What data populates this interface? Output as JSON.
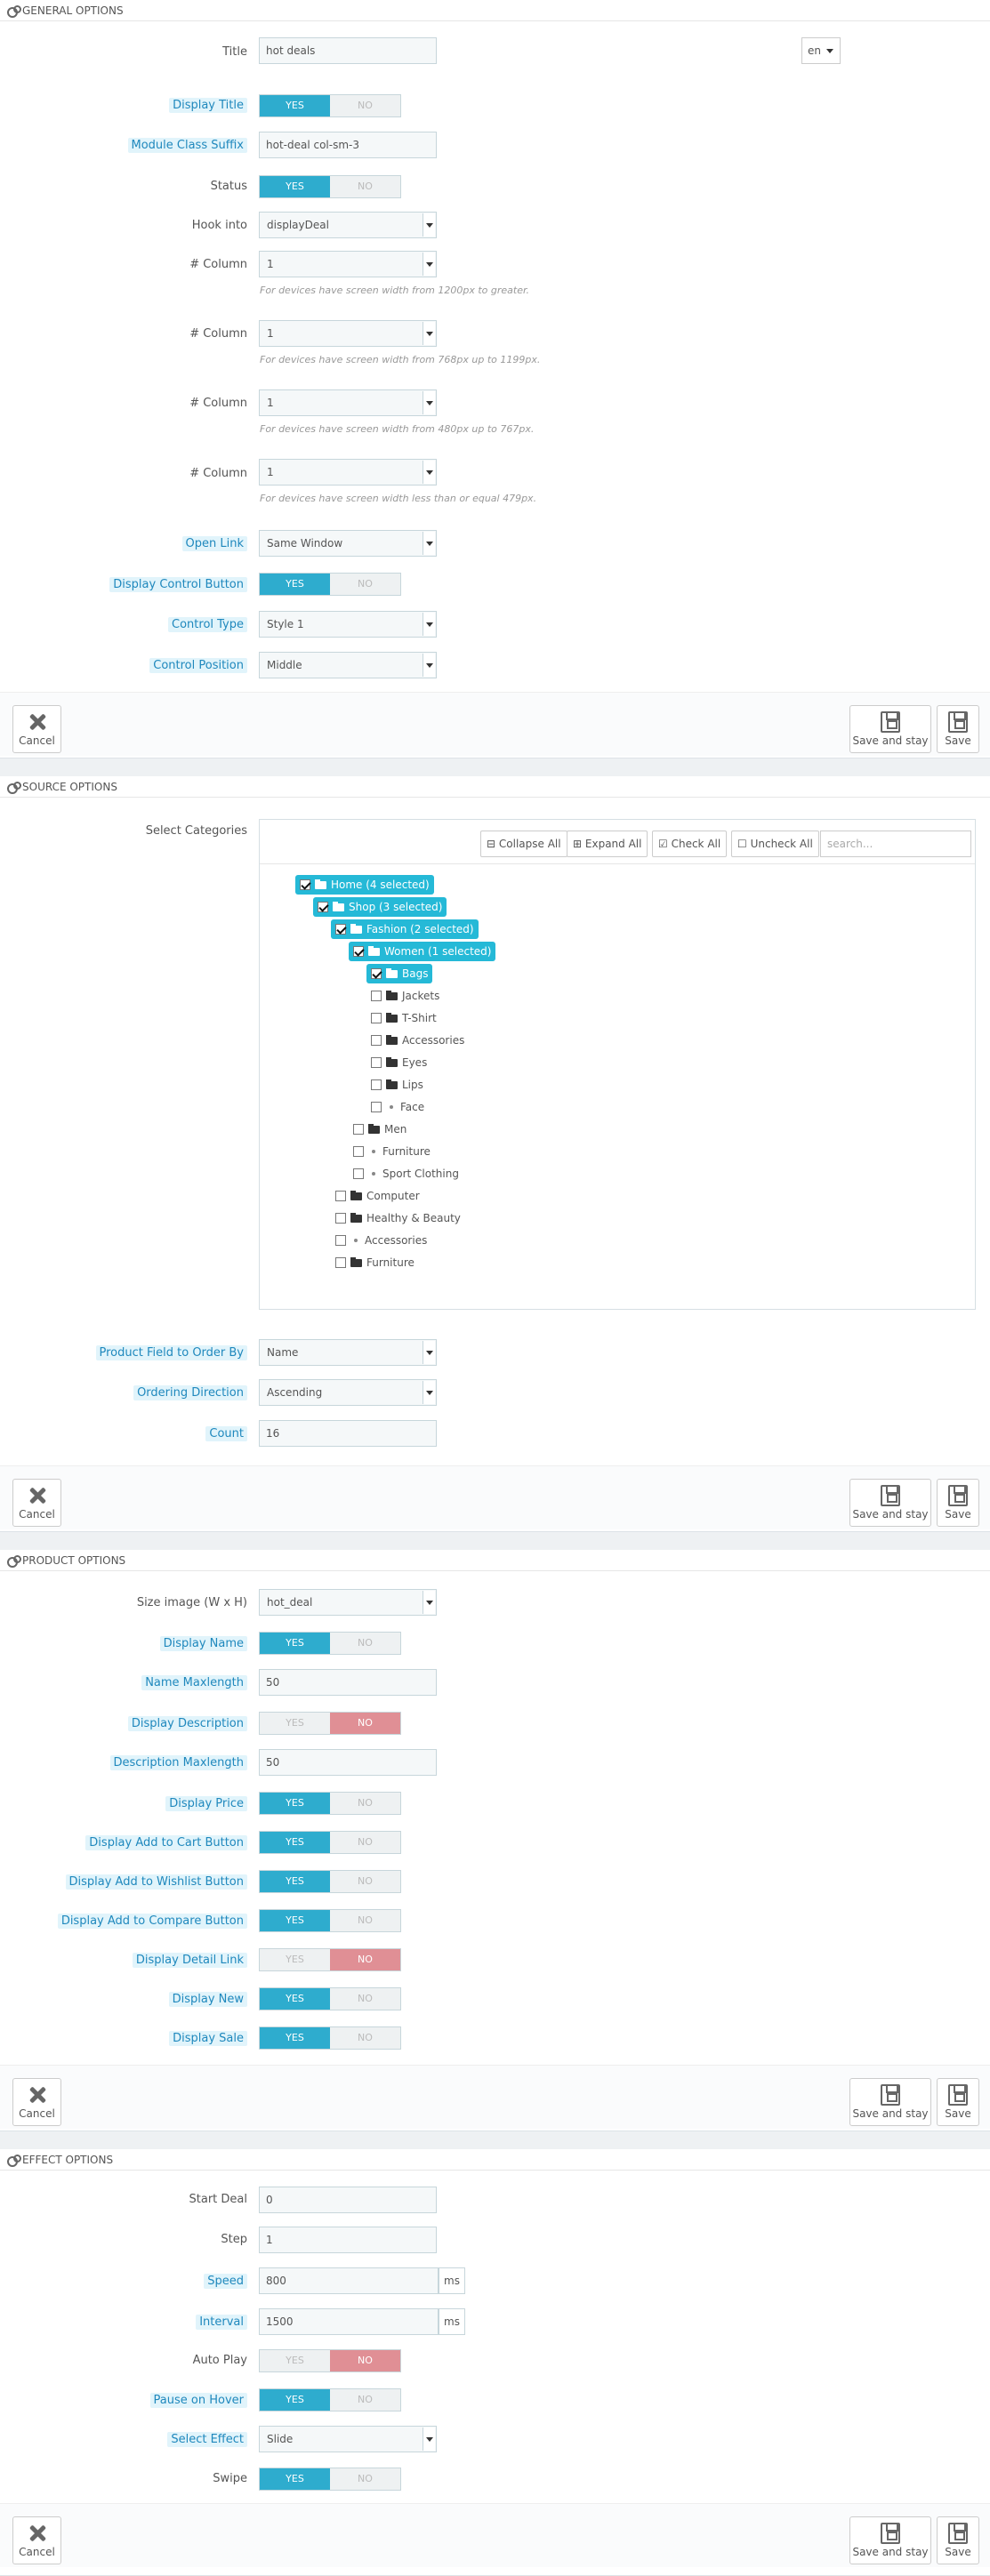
{
  "general": {
    "header": "GENERAL OPTIONS",
    "title_label": "Title",
    "title_value": "hot deals",
    "lang": "en",
    "display_title_label": "Display Title",
    "class_suffix_label": "Module Class Suffix",
    "class_suffix_value": "hot-deal col-sm-3",
    "status_label": "Status",
    "hook_label": "Hook into",
    "hook_value": "displayDeal",
    "column_label": "# Column",
    "columns": [
      {
        "value": "1",
        "help": "For devices have screen width from 1200px to greater."
      },
      {
        "value": "1",
        "help": "For devices have screen width from 768px up to 1199px."
      },
      {
        "value": "1",
        "help": "For devices have screen width from 480px up to 767px."
      },
      {
        "value": "1",
        "help": "For devices have screen width less than or equal 479px."
      }
    ],
    "open_link_label": "Open Link",
    "open_link_value": "Same Window",
    "display_control_label": "Display Control Button",
    "control_type_label": "Control Type",
    "control_type_value": "Style 1",
    "control_position_label": "Control Position",
    "control_position_value": "Middle"
  },
  "toggle": {
    "yes": "YES",
    "no": "NO"
  },
  "buttons": {
    "cancel": "Cancel",
    "save_stay": "Save and stay",
    "save": "Save"
  },
  "source": {
    "header": "SOURCE OPTIONS",
    "select_categories_label": "Select Categories",
    "collapse_all": "Collapse All",
    "expand_all": "Expand All",
    "check_all": "Check All",
    "uncheck_all": "Uncheck All",
    "search_placeholder": "search...",
    "tree": [
      {
        "label": "Home (4 selected)",
        "checked": true,
        "selected": true
      },
      {
        "label": "Shop (3 selected)",
        "checked": true,
        "selected": true
      },
      {
        "label": "Fashion (2 selected)",
        "checked": true,
        "selected": true
      },
      {
        "label": "Women (1 selected)",
        "checked": true,
        "selected": true
      },
      {
        "label": "Bags",
        "checked": true,
        "selected": true
      },
      {
        "label": "Jackets"
      },
      {
        "label": "T-Shirt"
      },
      {
        "label": "Accessories"
      },
      {
        "label": "Eyes"
      },
      {
        "label": "Lips"
      },
      {
        "label": "Face"
      },
      {
        "label": "Men"
      },
      {
        "label": "Furniture"
      },
      {
        "label": "Sport Clothing"
      },
      {
        "label": "Computer"
      },
      {
        "label": "Healthy & Beauty"
      },
      {
        "label": "Accessories"
      },
      {
        "label": "Furniture"
      }
    ],
    "order_by_label": "Product Field to Order By",
    "order_by_value": "Name",
    "ordering_label": "Ordering Direction",
    "ordering_value": "Ascending",
    "count_label": "Count",
    "count_value": "16"
  },
  "product": {
    "header": "PRODUCT OPTIONS",
    "size_label": "Size image (W x H)",
    "size_value": "hot_deal",
    "display_name_label": "Display Name",
    "name_max_label": "Name Maxlength",
    "name_max_value": "50",
    "display_desc_label": "Display Description",
    "desc_max_label": "Description Maxlength",
    "desc_max_value": "50",
    "display_price_label": "Display Price",
    "add_cart_label": "Display Add to Cart Button",
    "add_wishlist_label": "Display Add to Wishlist Button",
    "add_compare_label": "Display Add to Compare Button",
    "detail_link_label": "Display Detail Link",
    "display_new_label": "Display New",
    "display_sale_label": "Display Sale"
  },
  "effect": {
    "header": "EFFECT OPTIONS",
    "start_deal_label": "Start Deal",
    "start_deal_value": "0",
    "step_label": "Step",
    "step_value": "1",
    "speed_label": "Speed",
    "speed_value": "800",
    "interval_label": "Interval",
    "interval_value": "1500",
    "unit": "ms",
    "autoplay_label": "Auto Play",
    "pause_label": "Pause on Hover",
    "select_effect_label": "Select Effect",
    "select_effect_value": "Slide",
    "swipe_label": "Swipe"
  }
}
